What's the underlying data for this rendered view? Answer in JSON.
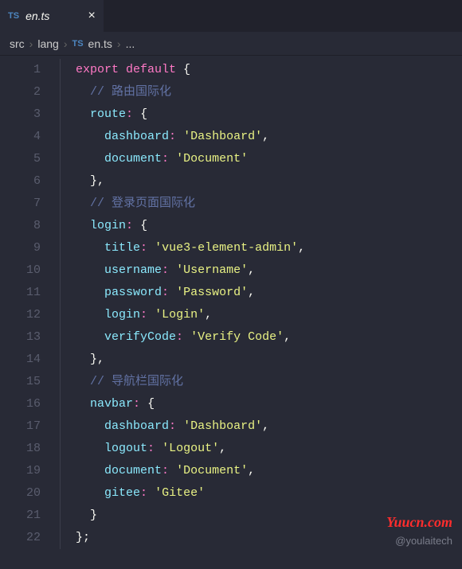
{
  "tab": {
    "icon_label": "TS",
    "filename": "en.ts"
  },
  "breadcrumb": {
    "parts": [
      "src",
      "lang"
    ],
    "file_icon": "TS",
    "file": "en.ts",
    "tail": "..."
  },
  "gutter": {
    "start": 1,
    "end": 22
  },
  "code": {
    "l1_export": "export",
    "l1_default": "default",
    "l1_brace": " {",
    "l2_comment": "// 路由国际化",
    "l3_prop": "route",
    "l4_prop": "dashboard",
    "l4_val": "'Dashboard'",
    "l5_prop": "document",
    "l5_val": "'Document'",
    "l7_comment": "// 登录页面国际化",
    "l8_prop": "login",
    "l9_prop": "title",
    "l9_val": "'vue3-element-admin'",
    "l10_prop": "username",
    "l10_val": "'Username'",
    "l11_prop": "password",
    "l11_val": "'Password'",
    "l12_prop": "login",
    "l12_val": "'Login'",
    "l13_prop": "verifyCode",
    "l13_val": "'Verify Code'",
    "l15_comment": "// 导航栏国际化",
    "l16_prop": "navbar",
    "l17_prop": "dashboard",
    "l17_val": "'Dashboard'",
    "l18_prop": "logout",
    "l18_val": "'Logout'",
    "l19_prop": "document",
    "l19_val": "'Document'",
    "l20_prop": "gitee",
    "l20_val": "'Gitee'"
  },
  "watermark": {
    "red": "Yuucn.com",
    "gray": "@youlaitech"
  }
}
